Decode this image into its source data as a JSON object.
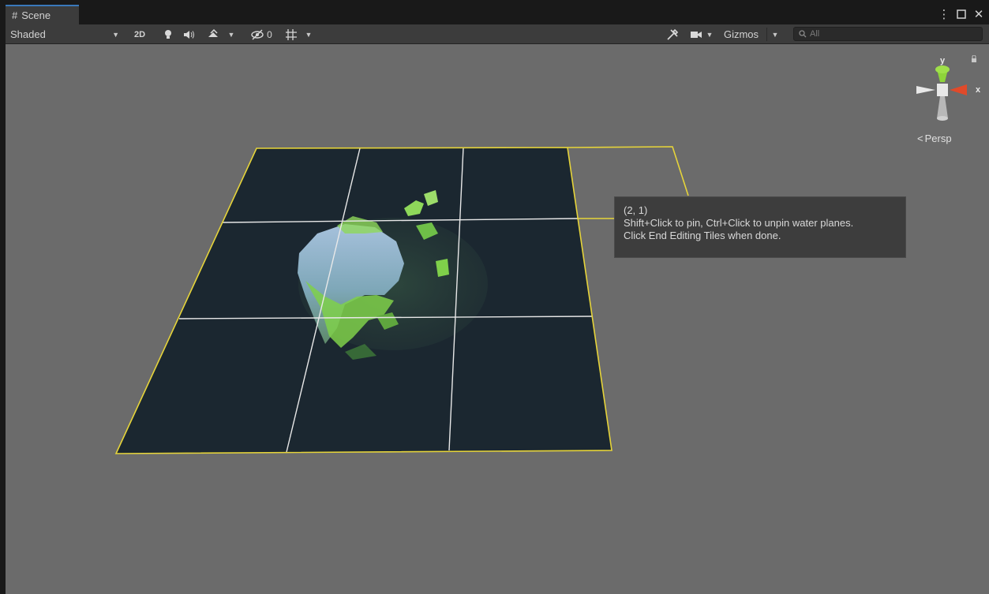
{
  "window": {
    "tab_label": "Scene",
    "tab_icon": "hash-icon",
    "controls": [
      "more-icon",
      "maximize-icon",
      "close-icon"
    ]
  },
  "toolbar": {
    "draw_mode": "Shaded",
    "toggle_2d": "2D",
    "hidden_count": "0",
    "gizmos_label": "Gizmos",
    "search_placeholder": "All"
  },
  "viewport": {
    "tooltip": {
      "title": "(2, 1)",
      "line1": "Shift+Click to pin, Ctrl+Click to unpin water planes.",
      "line2": "Click End Editing Tiles when done."
    },
    "orientation_gizmo": {
      "y_label": "y",
      "x_label": "x",
      "projection_label": "Persp"
    },
    "colors": {
      "background": "#6b6b6b",
      "water": "#1b2730",
      "grid_line": "#e8e8e8",
      "selection_outline": "#e6d43a",
      "x_axis": "#e04a2a",
      "y_axis": "#8ed43a"
    }
  }
}
